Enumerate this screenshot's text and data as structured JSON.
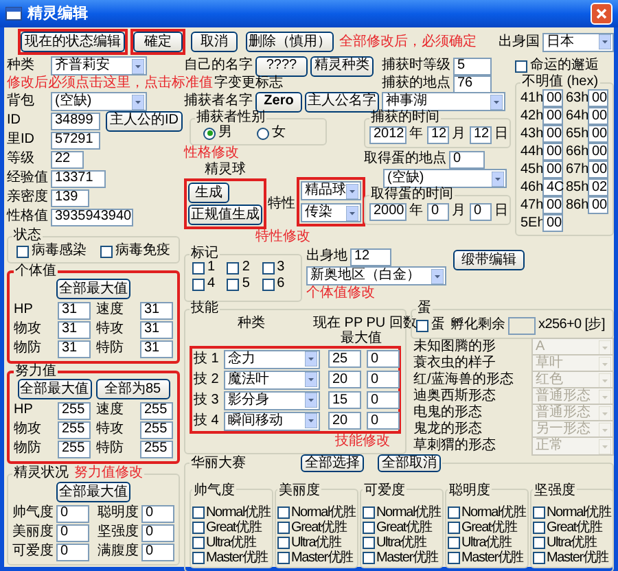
{
  "window": {
    "title": "精灵编辑"
  },
  "top_buttons": [
    {
      "label": "现在的状态编辑",
      "highlighted": true
    },
    {
      "label": "確定",
      "highlighted": true
    },
    {
      "label": "取消",
      "highlighted": false
    },
    {
      "label": "删除（慎用）",
      "highlighted": false
    }
  ],
  "confirm_note": "全部修改后，必须确定",
  "origin_country": {
    "label": "出身国",
    "value": "日本"
  },
  "species": {
    "label": "种类",
    "value": "齐普莉安",
    "note": "修改后必须点击这里，点击标准值"
  },
  "item": {
    "label": "背包",
    "value": "(空缺)"
  },
  "ids": [
    {
      "label": "ID",
      "value": "34899",
      "button": "主人公的ID"
    },
    {
      "label": "里ID",
      "value": "57291"
    }
  ],
  "stats": [
    {
      "label": "等级",
      "value": "22"
    },
    {
      "label": "经验值",
      "value": "13371"
    },
    {
      "label": "亲密度",
      "value": "139"
    },
    {
      "label": "性格值",
      "value": "3935943940"
    }
  ],
  "status": {
    "title": "状态",
    "options": [
      {
        "label": "病毒感染",
        "checked": false
      },
      {
        "label": "病毒免疫",
        "checked": false
      }
    ]
  },
  "ivs": {
    "title": "个体值",
    "highlighted": true,
    "note": "个体值修改",
    "buttons": [
      "全部最大值"
    ],
    "fields": [
      {
        "label": "HP",
        "value": "31"
      },
      {
        "label": "速度",
        "value": "31"
      },
      {
        "label": "物攻",
        "value": "31"
      },
      {
        "label": "特攻",
        "value": "31"
      },
      {
        "label": "物防",
        "value": "31"
      },
      {
        "label": "特防",
        "value": "31"
      }
    ]
  },
  "evs": {
    "title": "努力值",
    "highlighted": true,
    "note": "努力值修改",
    "buttons": [
      "全部最大值",
      "全部为85"
    ],
    "fields": [
      {
        "label": "HP",
        "value": "255"
      },
      {
        "label": "速度",
        "value": "255"
      },
      {
        "label": "物攻",
        "value": "255"
      },
      {
        "label": "特攻",
        "value": "255"
      },
      {
        "label": "物防",
        "value": "255"
      },
      {
        "label": "特防",
        "value": "255"
      }
    ]
  },
  "condition": {
    "title": "精灵状况",
    "highlighted": false,
    "buttons": [
      "全部最大值"
    ],
    "fields": [
      {
        "label": "帅气度",
        "value": "0"
      },
      {
        "label": "聪明度",
        "value": "0"
      },
      {
        "label": "美丽度",
        "value": "0"
      },
      {
        "label": "坚强度",
        "value": "0"
      },
      {
        "label": "可爱度",
        "value": "0"
      },
      {
        "label": "满腹度",
        "value": "0"
      }
    ]
  },
  "nickname": {
    "label": "自己的名字",
    "value": "????",
    "button": "精灵种类",
    "flag_label": "字变更标志"
  },
  "trainer": {
    "label": "捕获者名字",
    "value": "Zero",
    "button": "主人公名字"
  },
  "capture": {
    "level_label": "捕获时等级",
    "level": "5",
    "place_label": "捕获的地点",
    "place": "76",
    "place_name": "神事湖",
    "time": {
      "title": "捕获的时间",
      "parts": [
        {
          "value": "2012",
          "unit": "年"
        },
        {
          "value": "12",
          "unit": "月"
        },
        {
          "value": "12",
          "unit": "日"
        }
      ]
    }
  },
  "trainer_gender": {
    "title": "捕获者性别",
    "options": [
      {
        "label": "男",
        "selected": true
      },
      {
        "label": "女",
        "selected": false
      }
    ]
  },
  "nature": {
    "note": "性格修改",
    "ball_label": "精灵球",
    "buttons": [
      "生成",
      "正规值生成"
    ],
    "buttons_highlighted": true,
    "ability_label": "特性",
    "selects": [
      "精品球",
      "传染"
    ],
    "selects_highlighted": true,
    "ability_note": "特性修改"
  },
  "egg_source": {
    "place_label": "取得蛋的地点",
    "place": "0",
    "place_name": "(空缺)",
    "time": {
      "title": "取得蛋的时间",
      "parts": [
        {
          "value": "2000",
          "unit": "年"
        },
        {
          "value": "0",
          "unit": "月"
        },
        {
          "value": "0",
          "unit": "日"
        }
      ]
    }
  },
  "fateful": {
    "label": "命运的邂逅",
    "checked": false
  },
  "unknown_values": {
    "title": "不明值 (hex)",
    "cells": [
      {
        "label": "41h",
        "value": "00"
      },
      {
        "label": "63h",
        "value": "00"
      },
      {
        "label": "42h",
        "value": "00"
      },
      {
        "label": "64h",
        "value": "00"
      },
      {
        "label": "43h",
        "value": "00"
      },
      {
        "label": "65h",
        "value": "00"
      },
      {
        "label": "44h",
        "value": "00"
      },
      {
        "label": "66h",
        "value": "00"
      },
      {
        "label": "45h",
        "value": "00"
      },
      {
        "label": "67h",
        "value": "00"
      },
      {
        "label": "46h",
        "value": "4C"
      },
      {
        "label": "85h",
        "value": "02"
      },
      {
        "label": "47h",
        "value": "00"
      },
      {
        "label": "86h",
        "value": "00"
      },
      {
        "label": "5Eh",
        "value": "00"
      }
    ]
  },
  "marks": {
    "title": "标记",
    "items": [
      {
        "label": "1",
        "checked": false
      },
      {
        "label": "2",
        "checked": false
      },
      {
        "label": "3",
        "checked": false
      },
      {
        "label": "4",
        "checked": false
      },
      {
        "label": "5",
        "checked": false
      },
      {
        "label": "6",
        "checked": false
      }
    ]
  },
  "birthplace": {
    "label": "出身地",
    "value": "12",
    "region": "新奥地区（白金）"
  },
  "ribbon_button": "缎带编辑",
  "egg": {
    "title": "蛋",
    "checkbox": {
      "label": "蛋",
      "checked": false
    },
    "remaining_label": "孵化剩余",
    "suffix": "x256+0 [步]"
  },
  "forms": [
    {
      "label": "未知图腾的形",
      "value": "A",
      "disabled": true
    },
    {
      "label": "蓑衣虫的样子",
      "value": "草叶",
      "disabled": true
    },
    {
      "label": "红/蓝海兽的形态",
      "value": "红色",
      "disabled": true
    },
    {
      "label": "迪奥西斯形态",
      "value": "普通形态",
      "disabled": true
    },
    {
      "label": "电鬼的形态",
      "value": "普通形态",
      "disabled": true
    },
    {
      "label": "鬼龙的形态",
      "value": "另一形态",
      "disabled": true
    },
    {
      "label": "草刺猬的形态",
      "value": "正常",
      "disabled": true
    }
  ],
  "moves": {
    "title": "技能",
    "headers": [
      "种类",
      "现在 PP PU 回数"
    ],
    "max_label": "最大值",
    "highlighted": true,
    "note": "技能修改",
    "rows": [
      {
        "slot": "技 1",
        "name": "念力",
        "pp": "25",
        "pu": "0"
      },
      {
        "slot": "技 2",
        "name": "魔法叶",
        "pp": "20",
        "pu": "0"
      },
      {
        "slot": "技 3",
        "name": "影分身",
        "pp": "15",
        "pu": "0"
      },
      {
        "slot": "技 4",
        "name": "瞬间移动",
        "pp": "20",
        "pu": "0"
      }
    ]
  },
  "contest": {
    "title": "华丽大赛",
    "buttons": [
      "全部选择",
      "全部取消"
    ],
    "groups": [
      {
        "title": "帅气度",
        "items": [
          {
            "label": "Normal优胜",
            "checked": false
          },
          {
            "label": "Great优胜",
            "checked": false
          },
          {
            "label": "Ultra优胜",
            "checked": false
          },
          {
            "label": "Master优胜",
            "checked": false
          }
        ]
      },
      {
        "title": "美丽度",
        "items": [
          {
            "label": "Normal优胜",
            "checked": false
          },
          {
            "label": "Great优胜",
            "checked": false
          },
          {
            "label": "Ultra优胜",
            "checked": false
          },
          {
            "label": "Master优胜",
            "checked": false
          }
        ]
      },
      {
        "title": "可爱度",
        "items": [
          {
            "label": "Normal优胜",
            "checked": false
          },
          {
            "label": "Great优胜",
            "checked": false
          },
          {
            "label": "Ultra优胜",
            "checked": false
          },
          {
            "label": "Master优胜",
            "checked": false
          }
        ]
      },
      {
        "title": "聪明度",
        "items": [
          {
            "label": "Normal优胜",
            "checked": false
          },
          {
            "label": "Great优胜",
            "checked": false
          },
          {
            "label": "Ultra优胜",
            "checked": false
          },
          {
            "label": "Master优胜",
            "checked": false
          }
        ]
      },
      {
        "title": "坚强度",
        "items": [
          {
            "label": "Normal优胜",
            "checked": false
          },
          {
            "label": "Great优胜",
            "checked": false
          },
          {
            "label": "Ultra优胜",
            "checked": false
          },
          {
            "label": "Master优胜",
            "checked": false
          }
        ]
      }
    ]
  }
}
